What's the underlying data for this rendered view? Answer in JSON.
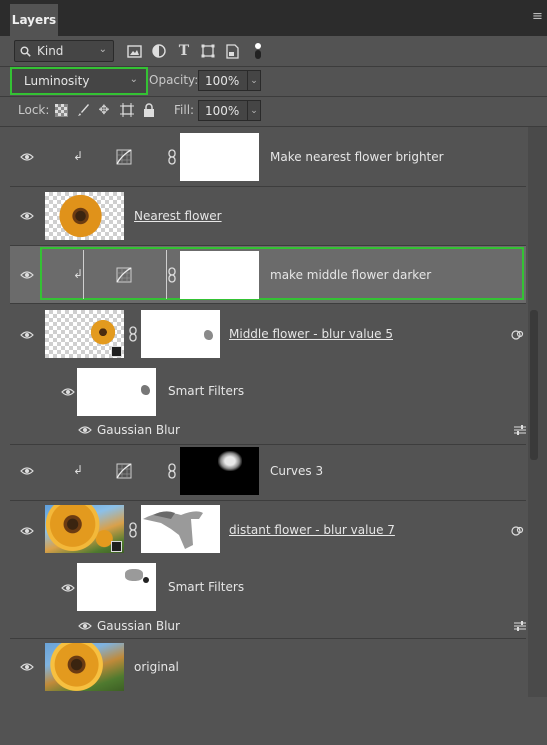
{
  "panel": {
    "tab_label": "Layers",
    "menu_icon": "hamburger-menu-icon"
  },
  "filter": {
    "kind_label": "Kind",
    "icons": [
      "pixel-layer-filter-icon",
      "adjustment-layer-filter-icon",
      "type-layer-filter-icon",
      "shape-layer-filter-icon",
      "smart-object-filter-icon",
      "filter-toggle-icon"
    ]
  },
  "blend": {
    "mode": "Luminosity",
    "opacity_label": "Opacity:",
    "opacity_value": "100%"
  },
  "lock": {
    "label": "Lock:",
    "fill_label": "Fill:",
    "fill_value": "100%",
    "icons": [
      "lock-transparent-pixels-icon",
      "lock-image-pixels-icon",
      "lock-position-icon",
      "lock-artboard-icon",
      "lock-all-icon"
    ]
  },
  "layers": [
    {
      "name": "Make nearest flower brighter",
      "type": "curves-adjustment",
      "clipped": true,
      "visible": true
    },
    {
      "name": "Nearest flower",
      "type": "pixel",
      "visible": true
    },
    {
      "name": "make middle flower darker",
      "type": "curves-adjustment",
      "clipped": true,
      "selected": true,
      "visible": true
    },
    {
      "name": "Middle flower - blur value 5",
      "type": "smart-object",
      "visible": true,
      "smart_filters_label": "Smart Filters",
      "filters": [
        "Gaussian Blur"
      ]
    },
    {
      "name": "Curves 3",
      "type": "curves-adjustment",
      "clipped": true,
      "visible": true
    },
    {
      "name": "distant flower - blur value 7",
      "type": "smart-object",
      "visible": true,
      "smart_filters_label": "Smart Filters",
      "filters": [
        "Gaussian Blur"
      ]
    },
    {
      "name": "original",
      "type": "pixel",
      "visible": true
    }
  ],
  "colors": {
    "panel_bg": "#535353",
    "selected_row": "#6b6b6b",
    "highlight_outline": "#34c234",
    "tab_bar": "#2c2c2c"
  }
}
